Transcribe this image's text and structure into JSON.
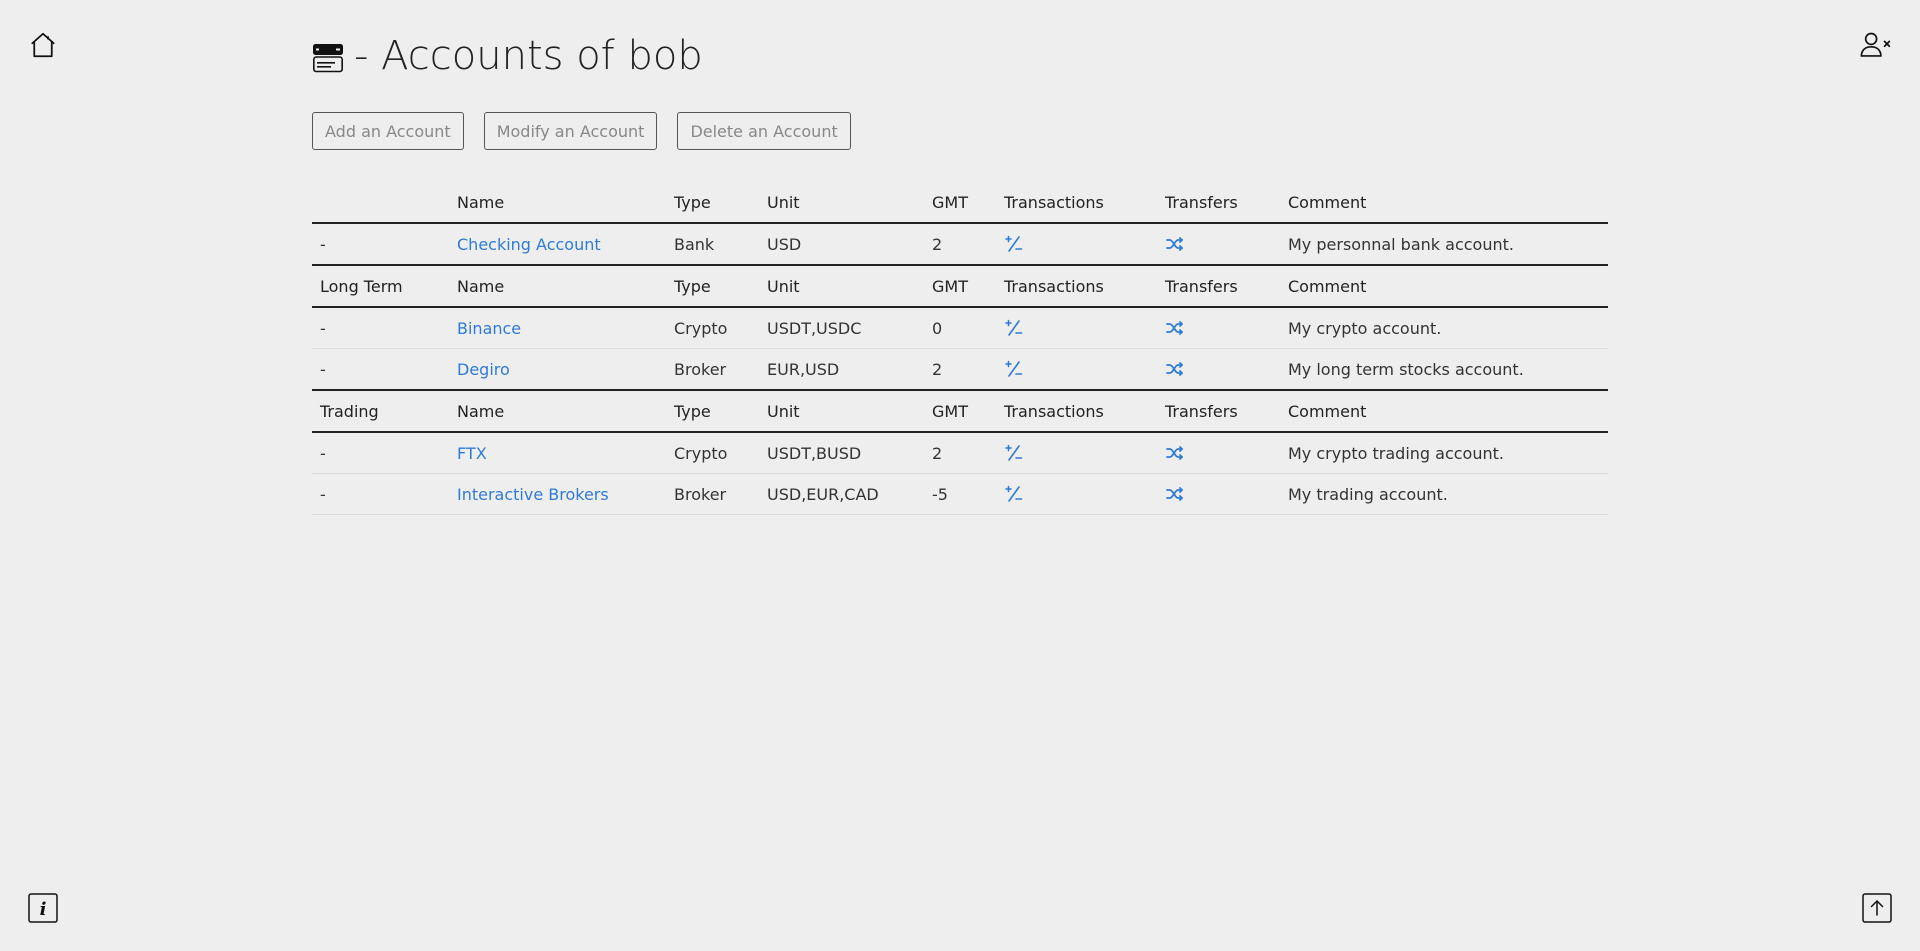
{
  "page": {
    "title": "- Accounts of bob"
  },
  "actions": {
    "add_label": "Add an Account",
    "modify_label": "Modify an Account",
    "delete_label": "Delete an Account"
  },
  "headers": {
    "name": "Name",
    "type": "Type",
    "unit": "Unit",
    "gmt": "GMT",
    "transactions": "Transactions",
    "transfers": "Transfers",
    "comment": "Comment"
  },
  "groups": [
    {
      "label": "",
      "accounts": [
        {
          "marker": "-",
          "name": "Checking Account",
          "type": "Bank",
          "unit": "USD",
          "gmt": "2",
          "comment": "My personnal bank account."
        }
      ]
    },
    {
      "label": "Long Term",
      "accounts": [
        {
          "marker": "-",
          "name": "Binance",
          "type": "Crypto",
          "unit": "USDT,USDC",
          "gmt": "0",
          "comment": "My crypto account."
        },
        {
          "marker": "-",
          "name": "Degiro",
          "type": "Broker",
          "unit": "EUR,USD",
          "gmt": "2",
          "comment": "My long term stocks account."
        }
      ]
    },
    {
      "label": "Trading",
      "accounts": [
        {
          "marker": "-",
          "name": "FTX",
          "type": "Crypto",
          "unit": "USDT,BUSD",
          "gmt": "2",
          "comment": "My crypto trading account."
        },
        {
          "marker": "-",
          "name": "Interactive Brokers",
          "type": "Broker",
          "unit": "USD,EUR,CAD",
          "gmt": "-5",
          "comment": "My trading account."
        }
      ]
    }
  ],
  "icons": {
    "home": "home-icon",
    "logout": "user-x-icon",
    "title": "server-icon",
    "transactions": "plus-minus-icon",
    "transfers": "shuffle-icon",
    "info": "info-icon",
    "scroll_top": "arrow-up-icon"
  },
  "colors": {
    "background": "#eeeeee",
    "link": "#2f7bd6",
    "text": "#222222"
  }
}
